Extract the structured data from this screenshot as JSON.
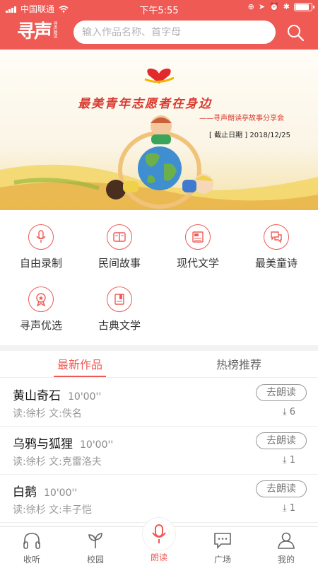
{
  "status": {
    "carrier": "中国联通",
    "time": "下午5:55",
    "battery_level": 0.85
  },
  "header": {
    "logo_text": "寻声",
    "logo_sub": "寻声朗读",
    "search_placeholder": "输入作品名称、首字母",
    "search_icon": "search-icon"
  },
  "banner": {
    "title": "最美青年志愿者在身边",
    "subtitle": "——寻声朗读亭故事分享会",
    "deadline_label": "[ 截止日期 ]",
    "deadline_date": "2018/12/25"
  },
  "categories": [
    {
      "label": "自由录制",
      "icon": "microphone-icon"
    },
    {
      "label": "民间故事",
      "icon": "book-icon"
    },
    {
      "label": "现代文学",
      "icon": "newspaper-icon"
    },
    {
      "label": "最美童诗",
      "icon": "chat-icon"
    },
    {
      "label": "寻声优选",
      "icon": "badge-icon"
    },
    {
      "label": "古典文学",
      "icon": "ancient-book-icon"
    }
  ],
  "tabs": [
    {
      "label": "最新作品",
      "active": true
    },
    {
      "label": "热榜推荐",
      "active": false
    }
  ],
  "works": [
    {
      "title": "黄山奇石",
      "duration": "10'00''",
      "reader": "读:徐杉",
      "author": "文:佚名",
      "button": "去朗读",
      "downloads": "6"
    },
    {
      "title": "乌鸦与狐狸",
      "duration": "10'00''",
      "reader": "读:徐杉",
      "author": "文:克雷洛夫",
      "button": "去朗读",
      "downloads": "1"
    },
    {
      "title": "白鹅",
      "duration": "10'00''",
      "reader": "读:徐杉",
      "author": "文:丰子恺",
      "button": "去朗读",
      "downloads": "1"
    }
  ],
  "nav": [
    {
      "label": "收听",
      "icon": "headphones-icon"
    },
    {
      "label": "校园",
      "icon": "sprout-icon"
    },
    {
      "label": "朗读",
      "icon": "microphone-icon",
      "active": true
    },
    {
      "label": "广场",
      "icon": "message-icon"
    },
    {
      "label": "我的",
      "icon": "user-icon"
    }
  ],
  "colors": {
    "accent": "#ef5a54"
  }
}
